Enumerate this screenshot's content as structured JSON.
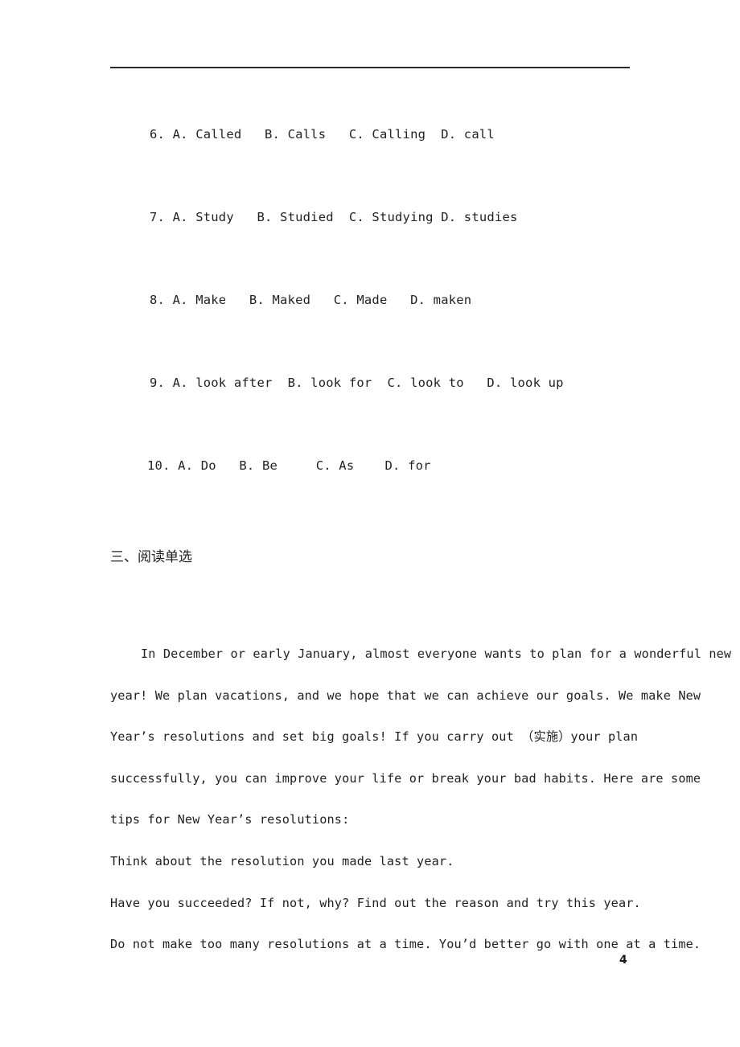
{
  "document": {
    "page_number": "4",
    "divider": "horizontal-rule"
  },
  "cloze_questions": [
    {
      "id": "q6",
      "text": "6. A. Called   B. Calls   C. Calling  D. call"
    },
    {
      "id": "q7",
      "text": "7. A. Study   B. Studied  C. Studying D. studies"
    },
    {
      "id": "q8",
      "text": "8. A. Make   B. Maked   C. Made   D. maken"
    },
    {
      "id": "q9",
      "text": "9. A. look after  B. look for  C. look to   D. look up"
    },
    {
      "id": "q10",
      "text": "10. A. Do   B. Be     C. As    D. for"
    }
  ],
  "section": {
    "heading": "三、阅读单选"
  },
  "passage": {
    "lines": [
      {
        "text": "In December or early January, almost everyone wants to plan for a wonderful new",
        "indent": true
      },
      {
        "text": "year! We plan vacations, and we hope that we can achieve our goals. We make New",
        "indent": false
      },
      {
        "text": "Year’s resolutions and set big goals! If you carry out （实施）your plan",
        "indent": false
      },
      {
        "text": "successfully, you can improve your life or break your bad habits. Here are some",
        "indent": false
      },
      {
        "text": "tips for New Year’s resolutions:",
        "indent": false
      },
      {
        "text": "Think about the resolution you made last year.",
        "indent": false
      },
      {
        "text": "Have you succeeded? If not, why? Find out the reason and try this year.",
        "indent": false
      },
      {
        "text": "Do not make too many resolutions at a time. You’d better go with one at a time.",
        "indent": false
      }
    ]
  }
}
